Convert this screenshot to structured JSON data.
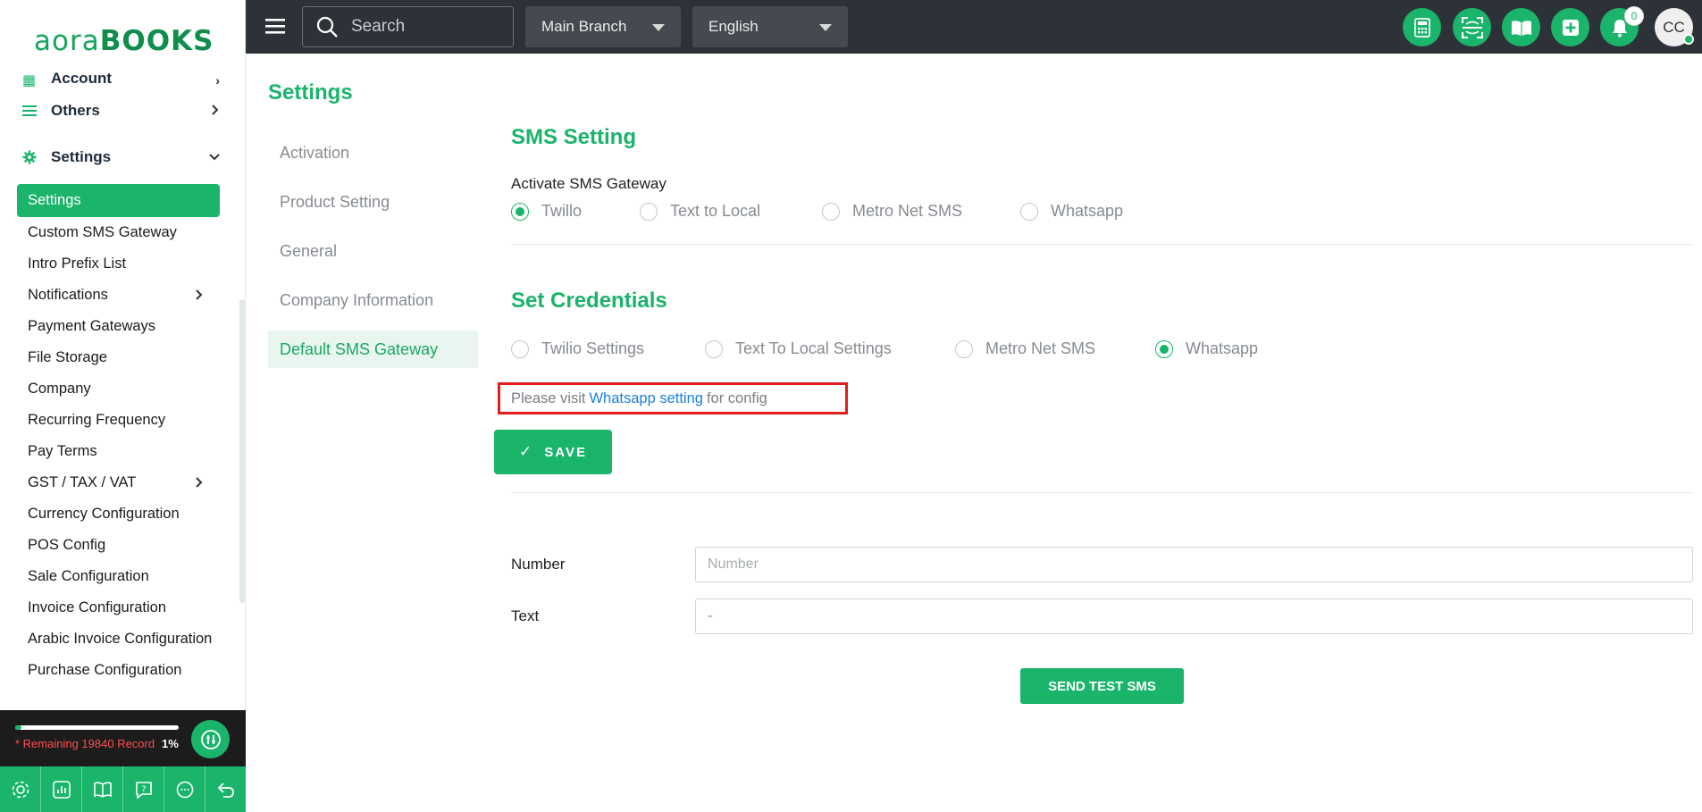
{
  "logo": {
    "part1": "aora",
    "part2": "BOOKS"
  },
  "sidebar": {
    "groups": [
      {
        "label": "Account",
        "icon": "building-icon"
      },
      {
        "label": "Others",
        "icon": "list-icon"
      },
      {
        "label": "Settings",
        "icon": "gear-icon"
      }
    ],
    "items": [
      {
        "label": "Settings",
        "active": true
      },
      {
        "label": "Custom SMS Gateway"
      },
      {
        "label": "Intro Prefix List"
      },
      {
        "label": "Notifications",
        "has_children": true
      },
      {
        "label": "Payment Gateways"
      },
      {
        "label": "File Storage"
      },
      {
        "label": "Company"
      },
      {
        "label": "Recurring Frequency"
      },
      {
        "label": "Pay Terms"
      },
      {
        "label": "GST / TAX / VAT",
        "has_children": true
      },
      {
        "label": "Currency Configuration"
      },
      {
        "label": "POS Config"
      },
      {
        "label": "Sale Configuration"
      },
      {
        "label": "Invoice Configuration"
      },
      {
        "label": "Arabic Invoice Configuration"
      },
      {
        "label": "Purchase Configuration"
      }
    ],
    "usage": {
      "prefix": "* Remaining 19840 Record",
      "percent_label": "1%",
      "percent": 1
    }
  },
  "topbar": {
    "search_placeholder": "Search",
    "branch": "Main Branch",
    "language": "English",
    "notification_count": "0",
    "avatar": "CC"
  },
  "page": {
    "title": "Settings",
    "nav": [
      {
        "label": "Activation"
      },
      {
        "label": "Product Setting"
      },
      {
        "label": "General"
      },
      {
        "label": "Company Information"
      },
      {
        "label": "Default SMS Gateway",
        "active": true
      }
    ],
    "sms": {
      "title": "SMS Setting",
      "gateway_label": "Activate SMS Gateway",
      "options": [
        "Twillo",
        "Text to Local",
        "Metro Net SMS",
        "Whatsapp"
      ],
      "selected": "Twillo"
    },
    "credentials": {
      "title": "Set Credentials",
      "options": [
        "Twilio Settings",
        "Text To Local Settings",
        "Metro Net SMS",
        "Whatsapp"
      ],
      "selected": "Whatsapp",
      "notice_prefix": "Please visit",
      "notice_link": "Whatsapp setting",
      "notice_suffix": "for config"
    },
    "save_label": "SAVE",
    "test": {
      "number_label": "Number",
      "number_placeholder": "Number",
      "text_label": "Text",
      "text_value": "-",
      "send_label": "SEND TEST SMS"
    }
  },
  "colors": {
    "brand": "#1ab46a",
    "topbar": "#2d3238",
    "notice_border": "#e41c1c",
    "link": "#1b7fe0"
  }
}
